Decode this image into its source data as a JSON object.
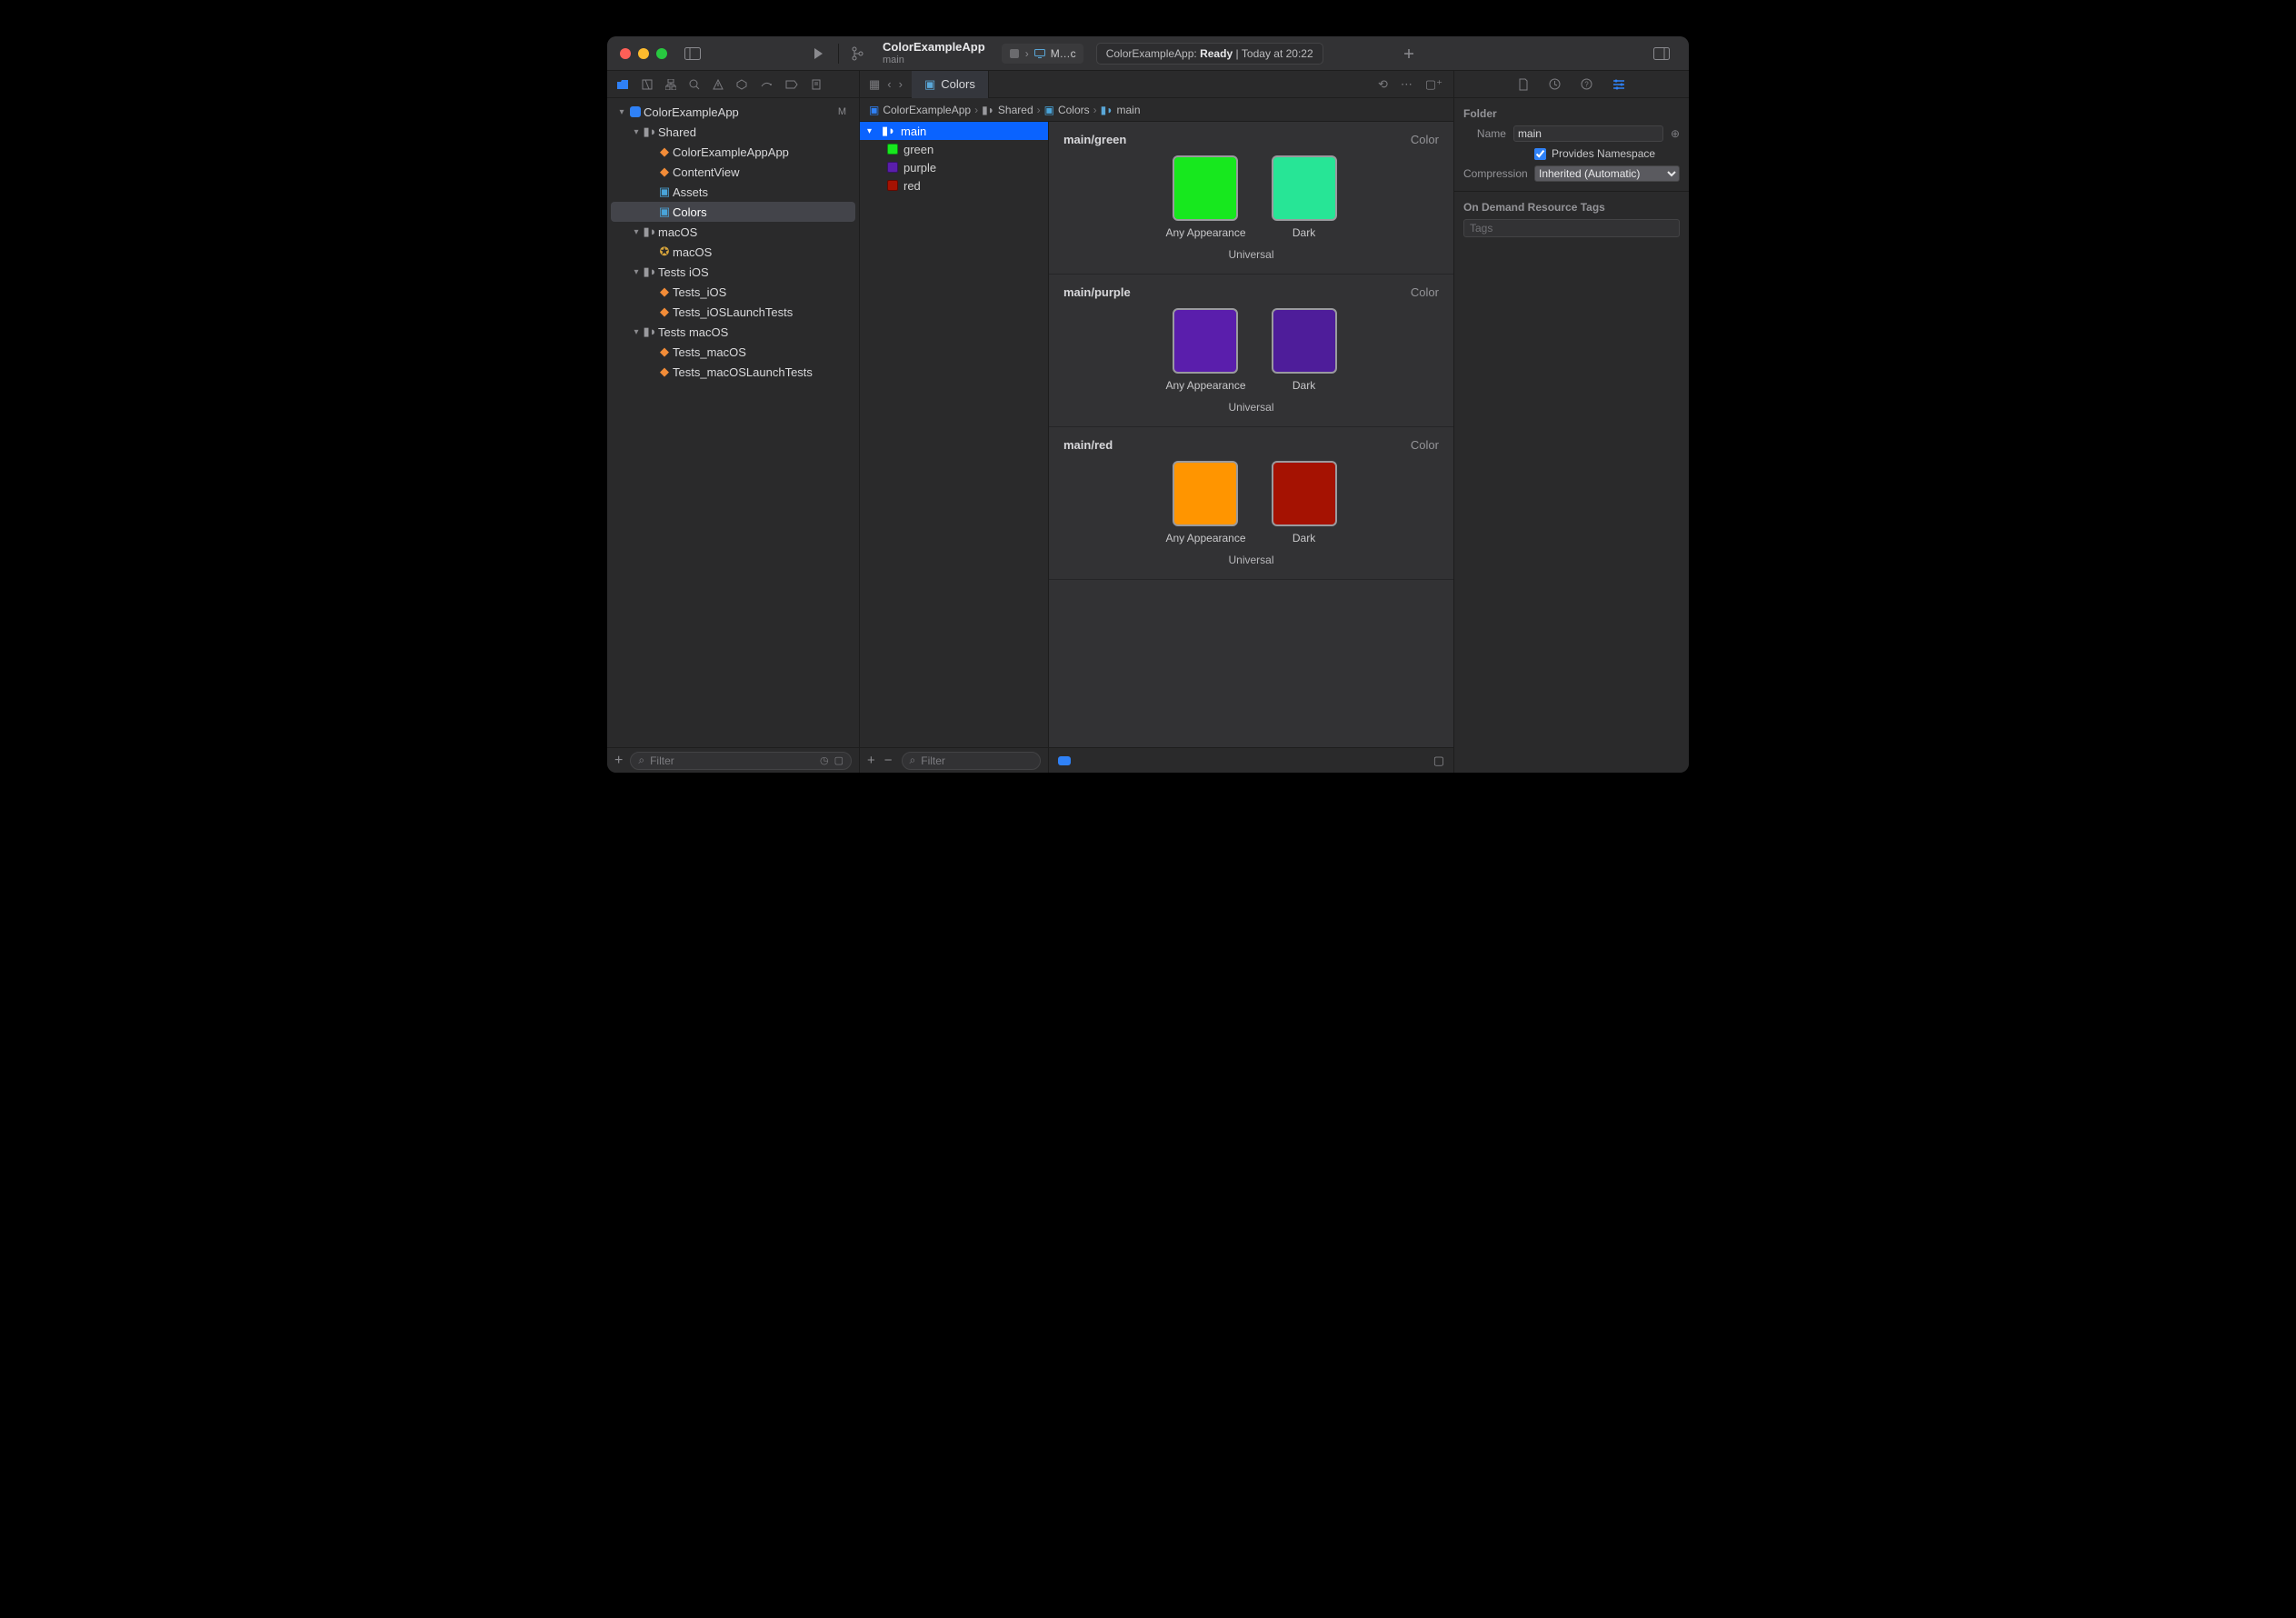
{
  "titlebar": {
    "branch_name": "ColorExampleApp",
    "branch_sub": "main",
    "scheme_truncated": "M…c",
    "status_prefix": "ColorExampleApp:",
    "status_state": "Ready",
    "status_time": "Today at 20:22"
  },
  "navigator": {
    "project": "ColorExampleApp",
    "project_badge": "M",
    "tree": {
      "shared": "Shared",
      "app_file": "ColorExampleAppApp",
      "content_view": "ContentView",
      "assets": "Assets",
      "colors": "Colors",
      "macos_group": "macOS",
      "macos_target": "macOS",
      "tests_ios_group": "Tests iOS",
      "tests_ios": "Tests_iOS",
      "tests_ios_launch": "Tests_iOSLaunchTests",
      "tests_macos_group": "Tests macOS",
      "tests_macos": "Tests_macOS",
      "tests_macos_launch": "Tests_macOSLaunchTests"
    },
    "filter_placeholder": "Filter"
  },
  "editor": {
    "tab_label": "Colors",
    "crumbs": {
      "c0": "ColorExampleApp",
      "c1": "Shared",
      "c2": "Colors",
      "c3": "main"
    },
    "outline": {
      "folder": "main",
      "green": "green",
      "purple": "purple",
      "red": "red",
      "filter_placeholder": "Filter"
    },
    "detail": {
      "green_title": "main/green",
      "purple_title": "main/purple",
      "red_title": "main/red",
      "kind": "Color",
      "any_label": "Any Appearance",
      "dark_label": "Dark",
      "universal_label": "Universal",
      "colors": {
        "green_any": "#17e81e",
        "green_dark": "#27e596",
        "purple_any": "#5a1eac",
        "purple_dark": "#4e1d9a",
        "red_any": "#ff9500",
        "red_dark": "#a51202"
      }
    }
  },
  "inspector": {
    "folder_heading": "Folder",
    "name_label": "Name",
    "name_value": "main",
    "provides_ns_label": "Provides Namespace",
    "compression_label": "Compression",
    "compression_value": "Inherited (Automatic)",
    "odr_heading": "On Demand Resource Tags",
    "tags_placeholder": "Tags"
  }
}
